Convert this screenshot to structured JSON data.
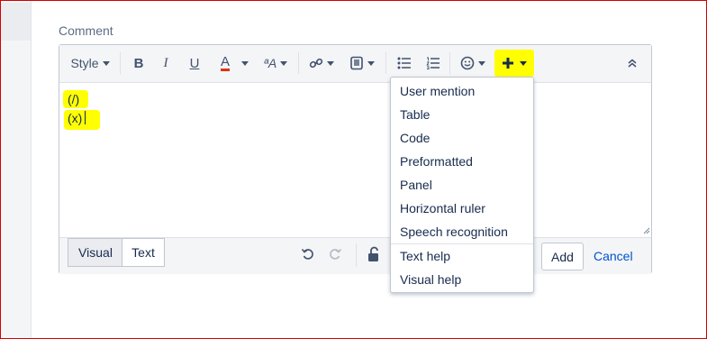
{
  "comment_label": "Comment",
  "toolbar": {
    "style_label": "Style",
    "bold": "B",
    "italic": "I",
    "underline": "U",
    "text_color": "A",
    "text_size": "ªA"
  },
  "editor_lines": [
    "(/)",
    "(x)"
  ],
  "tabs": {
    "visual": "Visual",
    "text": "Text"
  },
  "menu": {
    "items": [
      "User mention",
      "Table",
      "Code",
      "Preformatted",
      "Panel",
      "Horizontal ruler",
      "Speech recognition"
    ],
    "help": [
      "Text help",
      "Visual help"
    ]
  },
  "actions": {
    "add": "Add",
    "cancel": "Cancel"
  },
  "colors": {
    "highlight": "#ffff00",
    "link": "#0052cc",
    "text_color_underline": "#de350b"
  }
}
